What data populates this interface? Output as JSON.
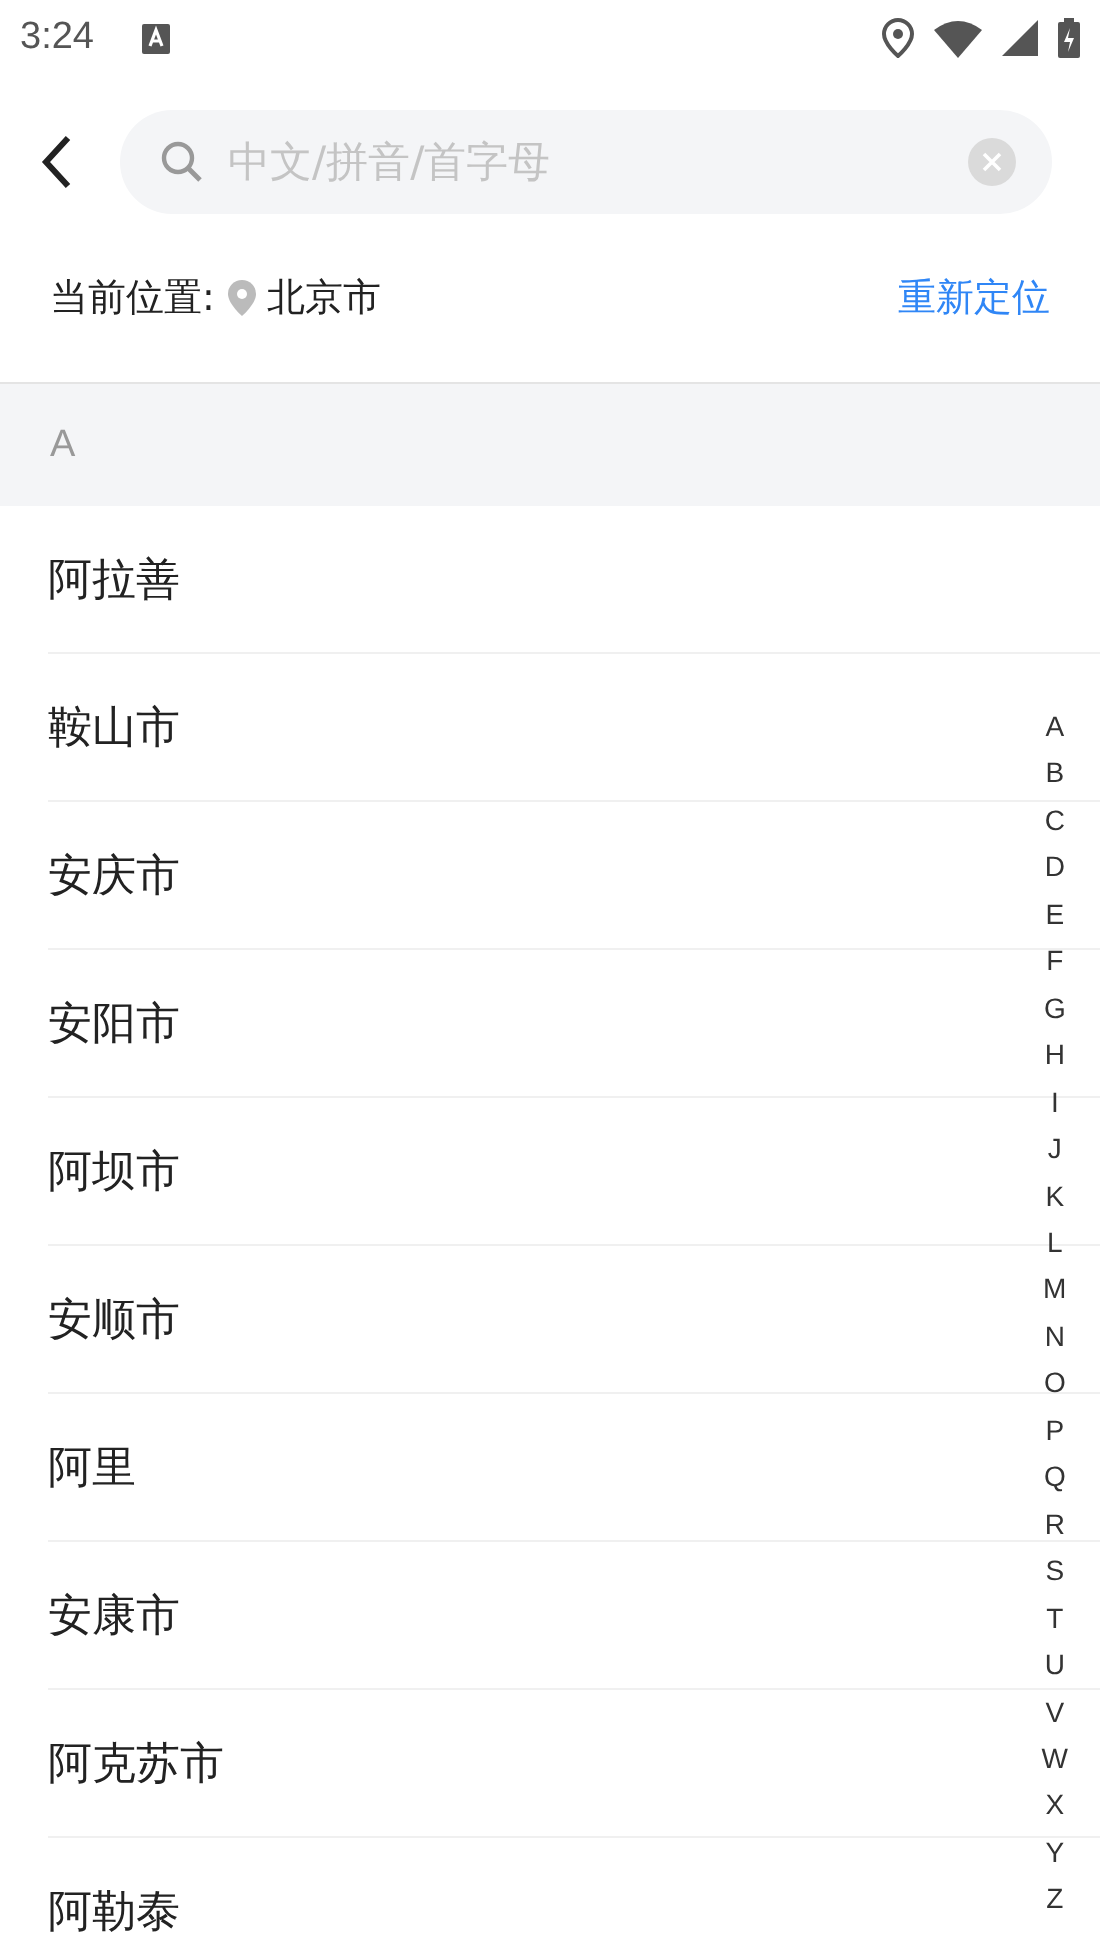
{
  "status_bar": {
    "time": "3:24"
  },
  "search": {
    "placeholder": "中文/拼音/首字母"
  },
  "location": {
    "label": "当前位置:",
    "city": "北京市",
    "action": "重新定位"
  },
  "sections": [
    {
      "letter": "A",
      "cities": [
        "阿拉善",
        "鞍山市",
        "安庆市",
        "安阳市",
        "阿坝市",
        "安顺市",
        "阿里",
        "安康市",
        "阿克苏市",
        "阿勒泰"
      ]
    }
  ],
  "index": [
    "A",
    "B",
    "C",
    "D",
    "E",
    "F",
    "G",
    "H",
    "I",
    "J",
    "K",
    "L",
    "M",
    "N",
    "O",
    "P",
    "Q",
    "R",
    "S",
    "T",
    "U",
    "V",
    "W",
    "X",
    "Y",
    "Z"
  ]
}
